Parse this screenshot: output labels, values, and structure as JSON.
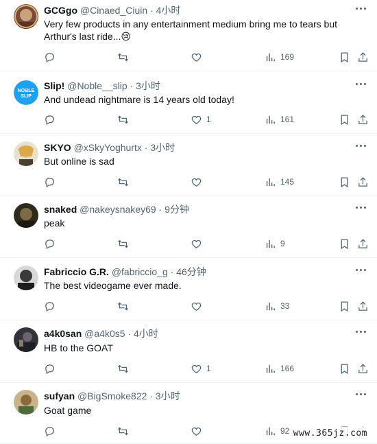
{
  "tweets": [
    {
      "name": "GCGgo",
      "handle": "@Cinaed_Ciuin",
      "time": "4小时",
      "text": "Very few products in any entertainment medium bring me to tears but Arthur's last ride...😢",
      "likes": "",
      "views": "169",
      "avatar_color": "#8a5a4a"
    },
    {
      "name": "Slip!",
      "handle": "@Noble__slip",
      "time": "3小时",
      "text": "And undead nightmare is 14 years old today!",
      "likes": "1",
      "views": "161",
      "avatar_color": "#1da1f2",
      "avatar_label": "NOBLE SLIP"
    },
    {
      "name": "SKYO",
      "handle": "@xSkyYoghurtx",
      "time": "3小时",
      "text": "But online is sad",
      "likes": "",
      "views": "145",
      "avatar_color": "#c9a64a"
    },
    {
      "name": "snaked",
      "handle": "@nakeysnakey69",
      "time": "9分钟",
      "text": "peak",
      "likes": "",
      "views": "9",
      "avatar_color": "#3b3a2a"
    },
    {
      "name": "Fabriccio G.R.",
      "handle": "@fabriccio_g",
      "time": "46分钟",
      "text": "The best videogame ever made.",
      "likes": "",
      "views": "33",
      "avatar_color": "#2c2c2c"
    },
    {
      "name": "a4k0san",
      "handle": "@a4k0s5",
      "time": "4小时",
      "text": "HB to the GOAT",
      "likes": "1",
      "views": "166",
      "avatar_color": "#3d3d46"
    },
    {
      "name": "sufyan",
      "handle": "@BigSmoke822",
      "time": "3小时",
      "text": "Goat game",
      "likes": "",
      "views": "92",
      "avatar_color": "#b79b6a"
    }
  ],
  "separator": "·",
  "watermark": "www.365jz.com",
  "colors": {
    "muted": "#536471",
    "text": "#0f1419",
    "border": "#eff3f4"
  },
  "icons": [
    "more-icon",
    "reply-icon",
    "retweet-icon",
    "like-icon",
    "views-icon",
    "bookmark-icon",
    "share-icon"
  ]
}
